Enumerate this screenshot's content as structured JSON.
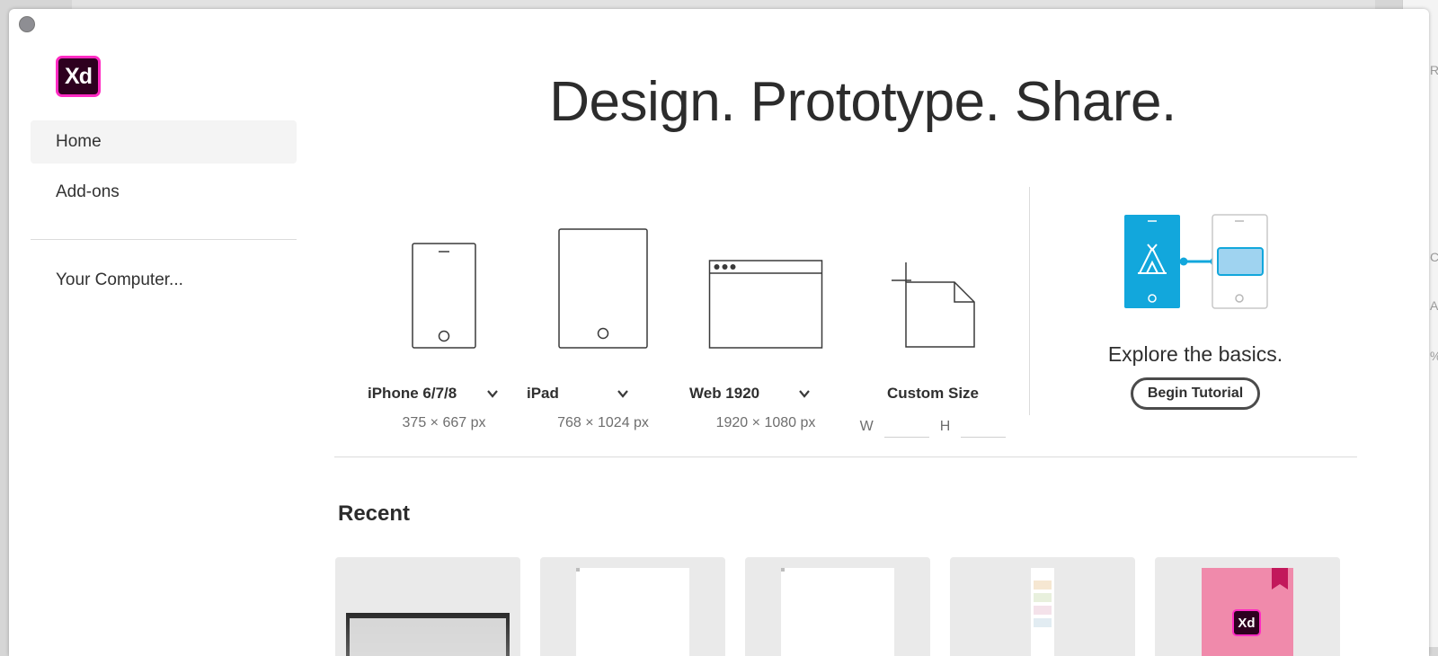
{
  "app": {
    "logo_text": "Xd",
    "accent": "#ff2bc2",
    "logo_bg": "#2e001f"
  },
  "sidebar": {
    "items": [
      {
        "label": "Home",
        "active": true
      },
      {
        "label": "Add-ons",
        "active": false
      },
      {
        "label": "Your Computer...",
        "active": false
      }
    ]
  },
  "main": {
    "headline": "Design. Prototype. Share.",
    "presets": [
      {
        "label": "iPhone 6/7/8",
        "size": "375 × 667 px",
        "icon": "phone-icon"
      },
      {
        "label": "iPad",
        "size": "768 × 1024 px",
        "icon": "tablet-icon"
      },
      {
        "label": "Web 1920",
        "size": "1920 × 1080 px",
        "icon": "browser-window-icon"
      }
    ],
    "custom": {
      "label": "Custom Size",
      "w_label": "W",
      "h_label": "H",
      "w_value": "",
      "h_value": ""
    },
    "tutorial": {
      "text": "Explore the basics.",
      "button": "Begin Tutorial",
      "accent": "#12a7dc"
    },
    "recent": {
      "title": "Recent",
      "items": [
        {
          "thumb": "photo"
        },
        {
          "thumb": "blank-artboard"
        },
        {
          "thumb": "blank-artboard"
        },
        {
          "thumb": "tall-artboard"
        },
        {
          "thumb": "xd-pink",
          "thumb_text": "Xd"
        }
      ]
    }
  },
  "background": {
    "right_letters": [
      "R",
      "C",
      "A",
      "%"
    ]
  }
}
